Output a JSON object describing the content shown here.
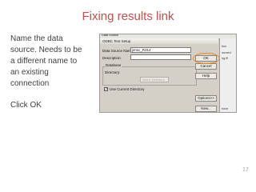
{
  "slide": {
    "title": "Fixing results link",
    "body_lines": [
      "Name the data",
      "source. Needs to be",
      "a different name to",
      "an existing",
      "connection"
    ],
    "instruction": "Click OK",
    "page_number": "17"
  },
  "dialog": {
    "title": "ODBC Text Setup",
    "top_label": "Data Source",
    "data_source_name_label": "Data Source Name:",
    "data_source_name_value": "jimsc_R314",
    "description_label": "Description:",
    "description_value": "",
    "database_group_label": "Database",
    "directory_label": "Directory:",
    "select_directory_label": "Select Directory...",
    "use_current_directory_label": "Use Current Directory",
    "use_current_directory_checked": true,
    "buttons": {
      "ok": "OK",
      "cancel": "Cancel",
      "help": "Help",
      "options": "Options>>",
      "new": "New..."
    },
    "side_fragments": [
      "tion",
      "oursed",
      "ng fil",
      "nove"
    ],
    "colors": {
      "highlight": "#f0851f",
      "title": "#c0504d"
    }
  }
}
